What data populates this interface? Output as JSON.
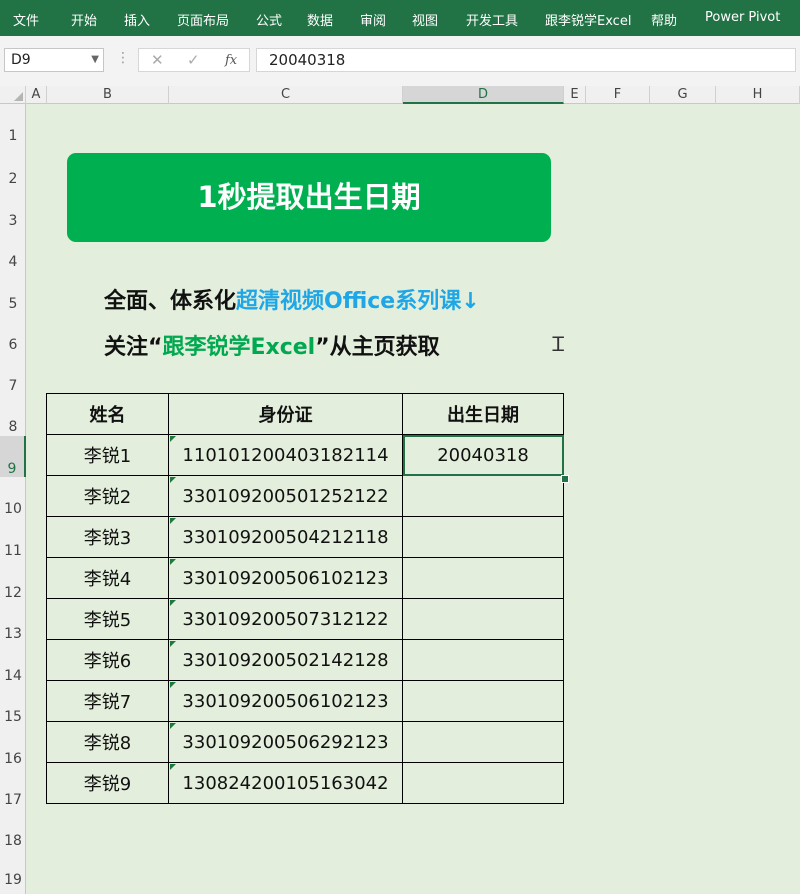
{
  "ribbon": {
    "tabs": [
      "文件",
      "开始",
      "插入",
      "页面布局",
      "公式",
      "数据",
      "审阅",
      "视图",
      "开发工具",
      "跟李锐学Excel",
      "帮助",
      "Power Pivot"
    ]
  },
  "formula_bar": {
    "name_box": "D9",
    "value": "20040318",
    "fx_label": "fx"
  },
  "columns": [
    "A",
    "B",
    "C",
    "D",
    "E",
    "F",
    "G",
    "H"
  ],
  "rows": [
    "1",
    "2",
    "3",
    "4",
    "5",
    "6",
    "7",
    "8",
    "9",
    "10",
    "11",
    "12",
    "13",
    "14",
    "15",
    "16",
    "17",
    "18",
    "19"
  ],
  "banner": {
    "title": "1秒提取出生日期"
  },
  "promo": {
    "line1_prefix": "全面、体系化",
    "line1_highlight": "超清视频Office系列课↓",
    "line2_prefix": "关注“",
    "line2_highlight": "跟李锐学Excel",
    "line2_suffix": "”从主页获取"
  },
  "table": {
    "headers": [
      "姓名",
      "身份证",
      "出生日期"
    ],
    "rows": [
      [
        "李锐1",
        "110101200403182114",
        "20040318"
      ],
      [
        "李锐2",
        "330109200501252122",
        ""
      ],
      [
        "李锐3",
        "330109200504212118",
        ""
      ],
      [
        "李锐4",
        "330109200506102123",
        ""
      ],
      [
        "李锐5",
        "330109200507312122",
        ""
      ],
      [
        "李锐6",
        "330109200502142128",
        ""
      ],
      [
        "李锐7",
        "330109200506102123",
        ""
      ],
      [
        "李锐8",
        "330109200506292123",
        ""
      ],
      [
        "李锐9",
        "130824200105163042",
        ""
      ]
    ]
  },
  "colors": {
    "ribbon": "#217346",
    "banner": "#00b050",
    "highlight_blue": "#1fa6e6",
    "highlight_green": "#00a84f",
    "sheet_background": "#e3efdc"
  }
}
